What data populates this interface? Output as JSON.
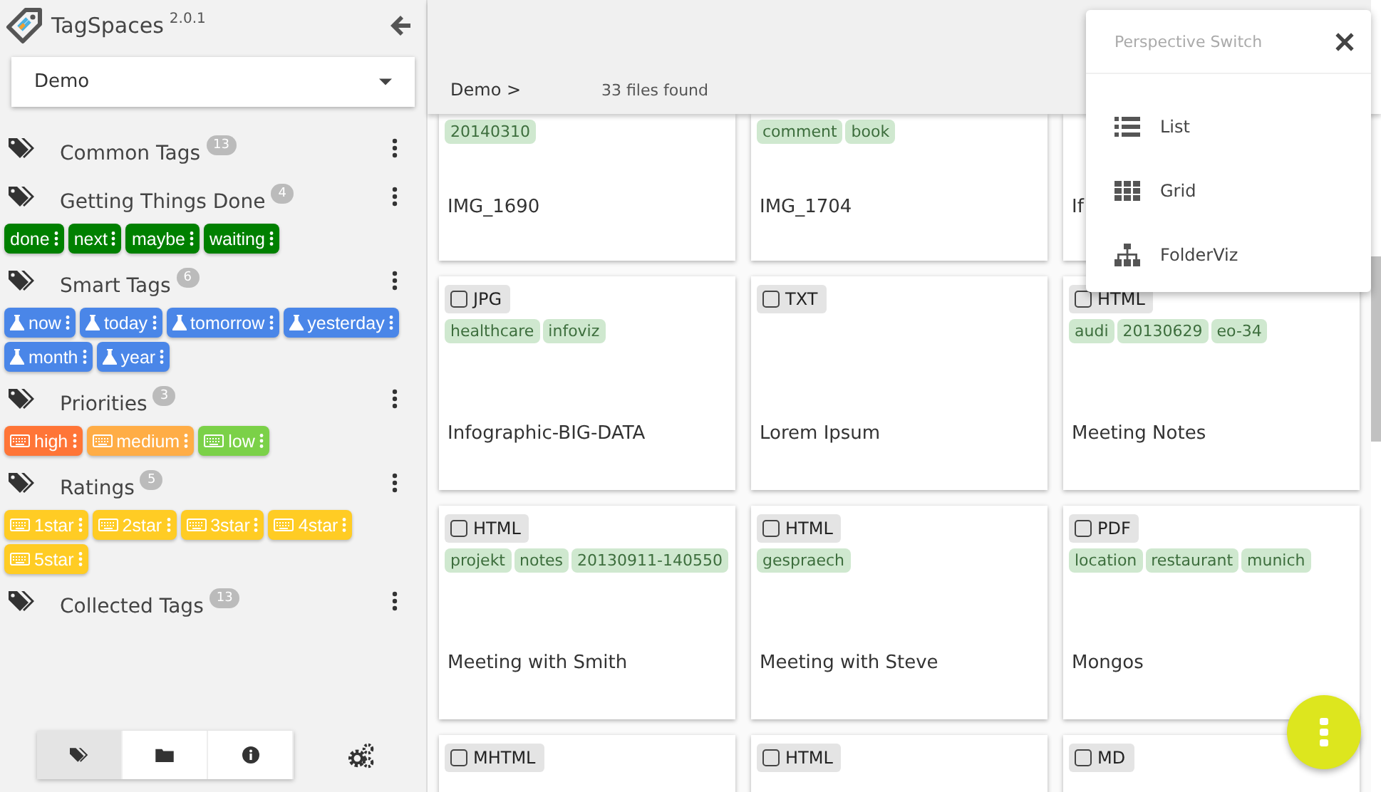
{
  "app": {
    "name": "TagSpaces",
    "version": "2.0.1"
  },
  "location": {
    "value": "Demo"
  },
  "tag_groups": [
    {
      "title": "Common Tags",
      "count": "13"
    },
    {
      "title": "Getting Things Done",
      "count": "4",
      "tags": [
        {
          "label": "done",
          "kind": "plain",
          "color": "#008000"
        },
        {
          "label": "next",
          "kind": "plain",
          "color": "#008000"
        },
        {
          "label": "maybe",
          "kind": "plain",
          "color": "#008000"
        },
        {
          "label": "waiting",
          "kind": "plain",
          "color": "#008000"
        }
      ]
    },
    {
      "title": "Smart Tags",
      "count": "6",
      "tags": [
        {
          "label": "now",
          "kind": "smart",
          "color": "#4a86e8"
        },
        {
          "label": "today",
          "kind": "smart",
          "color": "#4a86e8"
        },
        {
          "label": "tomorrow",
          "kind": "smart",
          "color": "#4a86e8"
        },
        {
          "label": "yesterday",
          "kind": "smart",
          "color": "#4a86e8"
        },
        {
          "label": "month",
          "kind": "smart",
          "color": "#4a86e8"
        },
        {
          "label": "year",
          "kind": "smart",
          "color": "#4a86e8"
        }
      ]
    },
    {
      "title": "Priorities",
      "count": "3",
      "tags": [
        {
          "label": "high",
          "kind": "keyboard",
          "color": "#ff7537"
        },
        {
          "label": "medium",
          "kind": "keyboard",
          "color": "#ffad46"
        },
        {
          "label": "low",
          "kind": "keyboard",
          "color": "#7bd148"
        }
      ]
    },
    {
      "title": "Ratings",
      "count": "5",
      "tags": [
        {
          "label": "1star",
          "kind": "keyboard",
          "color": "#ffcc24"
        },
        {
          "label": "2star",
          "kind": "keyboard",
          "color": "#ffcc24"
        },
        {
          "label": "3star",
          "kind": "keyboard",
          "color": "#ffcc24"
        },
        {
          "label": "4star",
          "kind": "keyboard",
          "color": "#ffcc24"
        },
        {
          "label": "5star",
          "kind": "keyboard",
          "color": "#ffcc24"
        }
      ]
    },
    {
      "title": "Collected Tags",
      "count": "13"
    }
  ],
  "sidebar_tabs": [
    {
      "kind": "tags",
      "selected": true
    },
    {
      "kind": "folder",
      "selected": false
    },
    {
      "kind": "info",
      "selected": false
    }
  ],
  "breadcrumb": "Demo >",
  "files_found": "33 files found",
  "files": [
    {
      "title": "IMG_1690",
      "tags": [
        "20140310"
      ]
    },
    {
      "title": "IMG_1704",
      "tags": [
        "comment",
        "book"
      ]
    },
    {
      "title": "If"
    },
    {
      "title": "Infographic-BIG-DATA",
      "type": "JPG",
      "checked": false,
      "tags": [
        "healthcare",
        "infoviz"
      ]
    },
    {
      "title": "Lorem Ipsum",
      "type": "TXT",
      "checked": false
    },
    {
      "title": "Meeting Notes",
      "type": "HTML",
      "checked": false,
      "tags": [
        "audi",
        "20130629",
        "eo-34"
      ]
    },
    {
      "title": "Meeting with Smith",
      "type": "HTML",
      "checked": false,
      "tags": [
        "projekt",
        "notes",
        "20130911-140550"
      ]
    },
    {
      "title": "Meeting with Steve",
      "type": "HTML",
      "checked": false,
      "tags": [
        "gespraech"
      ]
    },
    {
      "title": "Mongos",
      "type": "PDF",
      "checked": false,
      "tags": [
        "location",
        "restaurant",
        "munich"
      ]
    },
    {
      "type": "MHTML",
      "checked": false
    },
    {
      "type": "HTML",
      "checked": false
    },
    {
      "type": "MD",
      "checked": false
    }
  ],
  "perspective_switch": {
    "title": "Perspective Switch",
    "items": [
      {
        "label": "List",
        "kind": "list"
      },
      {
        "label": "Grid",
        "kind": "grid"
      },
      {
        "label": "FolderViz",
        "kind": "tree"
      }
    ]
  }
}
